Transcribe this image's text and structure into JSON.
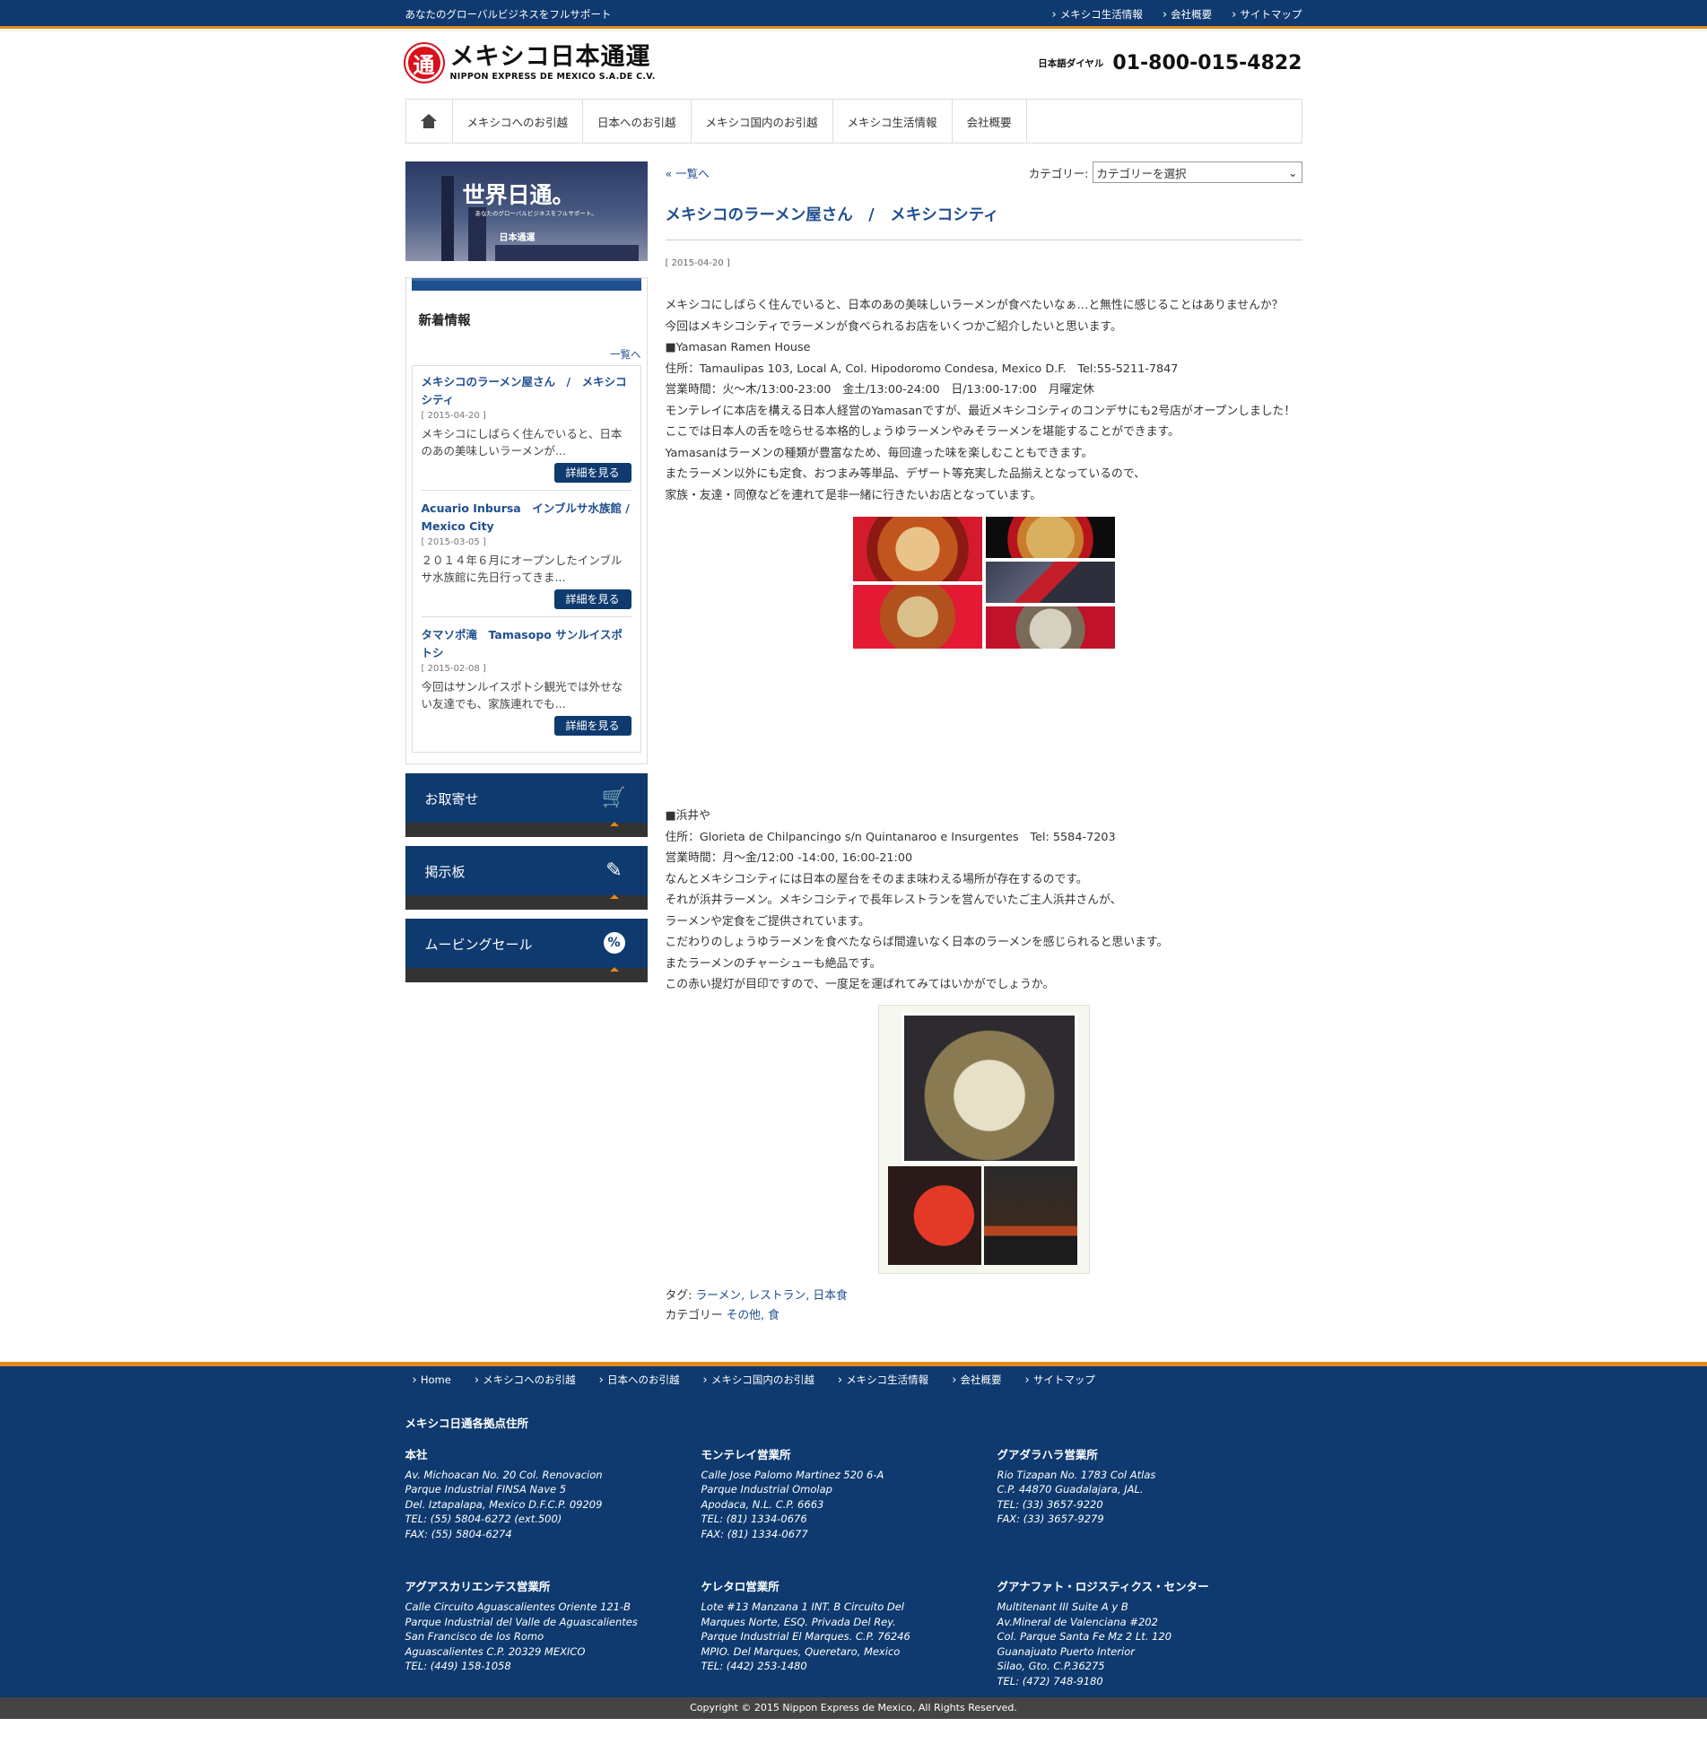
{
  "topbar": {
    "tagline": "あなたのグローバルビジネスをフルサポート",
    "links": [
      "メキシコ生活情報",
      "会社概要",
      "サイトマップ"
    ]
  },
  "header": {
    "logo_mark": "通",
    "logo_jp": "メキシコ日本通運",
    "logo_en": "NIPPON EXPRESS DE MEXICO S.A.DE C.V.",
    "phone_label": "日本語ダイヤル",
    "phone_number": "01-800-015-4822"
  },
  "nav": [
    "メキシコへのお引越",
    "日本へのお引越",
    "メキシコ国内のお引越",
    "メキシコ生活情報",
    "会社概要"
  ],
  "banner": {
    "title": "世界日通。",
    "subtitle": "あなたのグローバルビジネスをフルサポート。",
    "brand": "日本通運"
  },
  "news": {
    "heading": "新着情報",
    "more": "一覧へ",
    "items": [
      {
        "title": "メキシコのラーメン屋さん　/　メキシコシティ",
        "date": "[ 2015-04-20 ]",
        "excerpt": "メキシコにしばらく住んでいると、日本のあの美味しいラーメンが...",
        "button": "詳細を見る"
      },
      {
        "title": "Acuario Inbursa　インブルサ水族館 / Mexico City",
        "date": "[ 2015-03-05 ]",
        "excerpt": "２０１４年６月にオープンしたインブルサ水族館に先日行ってきま...",
        "button": "詳細を見る"
      },
      {
        "title": "タマソポ滝　Tamasopo サンルイスポトシ",
        "date": "[ 2015-02-08 ]",
        "excerpt": "今回はサンルイスポトシ観光では外せない友達でも、家族連れでも...",
        "button": "詳細を見る"
      }
    ]
  },
  "side_buttons": [
    {
      "label": "お取寄せ",
      "icon": "cart-icon",
      "glyph": "🛒"
    },
    {
      "label": "掲示板",
      "icon": "edit-icon",
      "glyph": "✎"
    },
    {
      "label": "ムービングセール",
      "icon": "percent-icon",
      "glyph": "%"
    }
  ],
  "article": {
    "back": "« 一覧へ",
    "category_label": "カテゴリー:",
    "category_select": "カテゴリーを選択",
    "title": "メキシコのラーメン屋さん　/　メキシコシティ",
    "date": "[ 2015-04-20 ]",
    "para1": [
      "メキシコにしばらく住んでいると、日本のあの美味しいラーメンが食べたいなぁ…と無性に感じることはありませんか？",
      "今回はメキシコシティでラーメンが食べられるお店をいくつかご紹介したいと思います。",
      "■Yamasan Ramen House",
      "住所：Tamaulipas 103, Local A, Col. Hipodoromo Condesa, Mexico D.F.　Tel:55-5211-7847",
      "営業時間：火～木/13:00-23:00　金土/13:00-24:00　日/13:00-17:00　月曜定休",
      "モンテレイに本店を構える日本人経営のYamasanですが、最近メキシコシティのコンデサにも2号店がオープンしました！",
      "ここでは日本人の舌を唸らせる本格的しょうゆラーメンやみそラーメンを堪能することができます。",
      "Yamasanはラーメンの種類が豊富なため、毎回違った味を楽しむこともできます。",
      "またラーメン以外にも定食、おつまみ等単品、デザート等充実した品揃えとなっているので、",
      "家族・友達・同僚などを連れて是非一緒に行きたいお店となっています。"
    ],
    "para2": [
      "■浜井や",
      "住所：Glorieta de Chilpancingo s/n Quintanaroo e Insurgentes　Tel: 5584-7203",
      "営業時間：月～金/12:00 -14:00, 16:00-21:00",
      "なんとメキシコシティには日本の屋台をそのまま味わえる場所が存在するのです。",
      "それが浜井ラーメン。メキシコシティで長年レストランを営んでいたご主人浜井さんが、",
      "ラーメンや定食をご提供されています。",
      "こだわりのしょうゆラーメンを食べたならば間違いなく日本のラーメンを感じられると思います。",
      "またラーメンのチャーシューも絶品です。",
      "この赤い提灯が目印ですので、一度足を運ばれてみてはいかがでしょうか。"
    ],
    "tags_label": "タグ:",
    "tags": "ラーメン, レストラン, 日本食",
    "cats_label": "カテゴリー",
    "cats": "その他, 食"
  },
  "footer": {
    "nav": [
      "Home",
      "メキシコへのお引越",
      "日本へのお引越",
      "メキシコ国内のお引越",
      "メキシコ生活情報",
      "会社概要",
      "サイトマップ"
    ],
    "heading": "メキシコ日通各拠点住所",
    "offices": [
      {
        "name": "本社",
        "lines": [
          "Av. Michoacan No. 20 Col. Renovacion",
          "Parque Industrial FINSA Nave 5",
          "Del. Iztapalapa, Mexico D.F.C.P. 09209",
          "TEL: (55) 5804-6272 (ext.500)",
          "FAX: (55) 5804-6274"
        ]
      },
      {
        "name": "モンテレイ営業所",
        "lines": [
          "Calle Jose Palomo Martinez 520 6-A",
          "Parque Industrial Omolap",
          "Apodaca, N.L. C.P. 6663",
          "TEL: (81) 1334-0676",
          "FAX: (81) 1334-0677"
        ]
      },
      {
        "name": "グアダラハラ営業所",
        "lines": [
          "Rio Tizapan No. 1783 Col Atlas",
          "C.P. 44870 Guadalajara, JAL.",
          "TEL: (33) 3657-9220",
          "FAX: (33) 3657-9279"
        ]
      },
      {
        "name": "アグアスカリエンテス営業所",
        "lines": [
          "Calle Circuito Aguascalientes Oriente 121-B",
          "Parque Industrial del Valle de Aguascalientes",
          "San Francisco de los Romo",
          "Aguascalientes C.P. 20329 MEXICO",
          "TEL: (449) 158-1058"
        ]
      },
      {
        "name": "ケレタロ営業所",
        "lines": [
          "Lote #13 Manzana 1 INT. B Circuito Del",
          "Marques Norte, ESQ. Privada Del Rey.",
          "Parque Industrial El Marques. C.P. 76246",
          "MPIO. Del Marques, Queretaro, Mexico",
          "TEL: (442) 253-1480"
        ]
      },
      {
        "name": "グアナファト・ロジスティクス・センター",
        "lines": [
          "Multitenant III Suite A y B",
          "Av.Mineral de Valenciana #202",
          "Col. Parque Santa Fe Mz 2 Lt. 120",
          "Guanajuato Puerto Interior",
          "Silao, Gto. C.P.36275",
          "TEL: (472) 748-9180"
        ]
      }
    ],
    "copyright": "Copyright © 2015 Nippon Express de Mexico, All Rights Reserved."
  }
}
